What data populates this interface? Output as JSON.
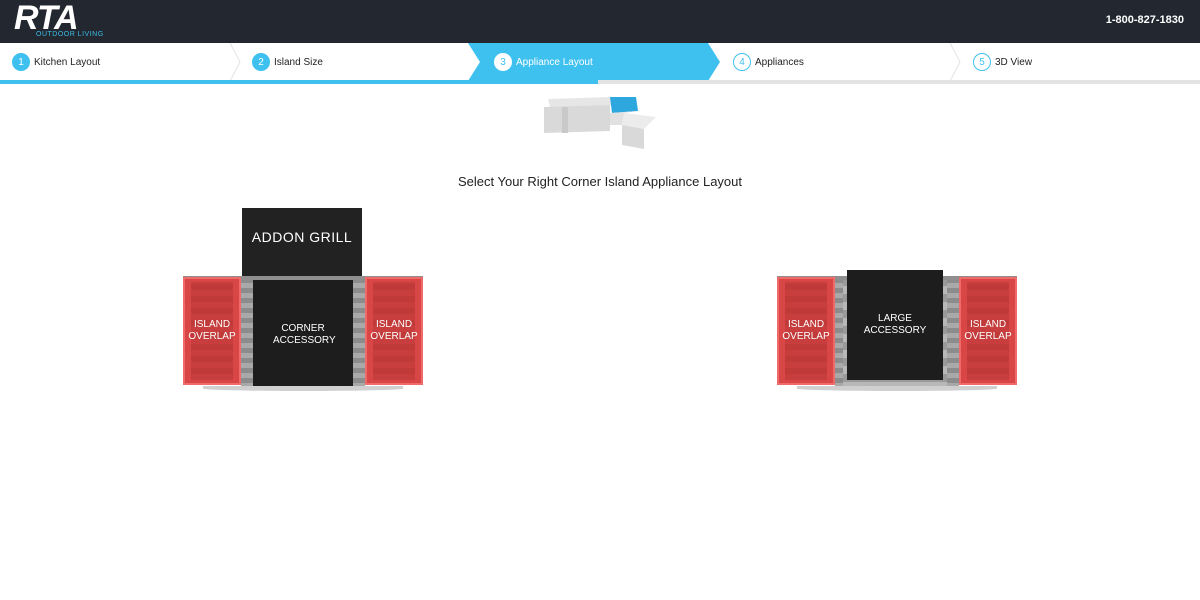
{
  "header": {
    "logo_text": "RTA",
    "logo_sub": "OUTDOOR LIVING",
    "phone": "1-800-827-1830"
  },
  "steps": [
    {
      "num": "1",
      "label": "Kitchen Layout",
      "state": "done"
    },
    {
      "num": "2",
      "label": "Island Size",
      "state": "done"
    },
    {
      "num": "3",
      "label": "Appliance Layout",
      "state": "current"
    },
    {
      "num": "4",
      "label": "Appliances",
      "state": "todo"
    },
    {
      "num": "5",
      "label": "3D View",
      "state": "todo"
    }
  ],
  "page_title": "Select Your Right Corner Island Appliance Layout",
  "options": [
    {
      "addon": "ADDON GRILL",
      "left_overlap": "ISLAND OVERLAP",
      "core": "CORNER ACCESSORY",
      "right_overlap": "ISLAND OVERLAP"
    },
    {
      "left_overlap": "ISLAND OVERLAP",
      "core": "LARGE ACCESSORY",
      "right_overlap": "ISLAND OVERLAP"
    }
  ],
  "colors": {
    "accent": "#3fc1ef",
    "header_bg": "#232830",
    "overlap_red": "#d94646"
  }
}
